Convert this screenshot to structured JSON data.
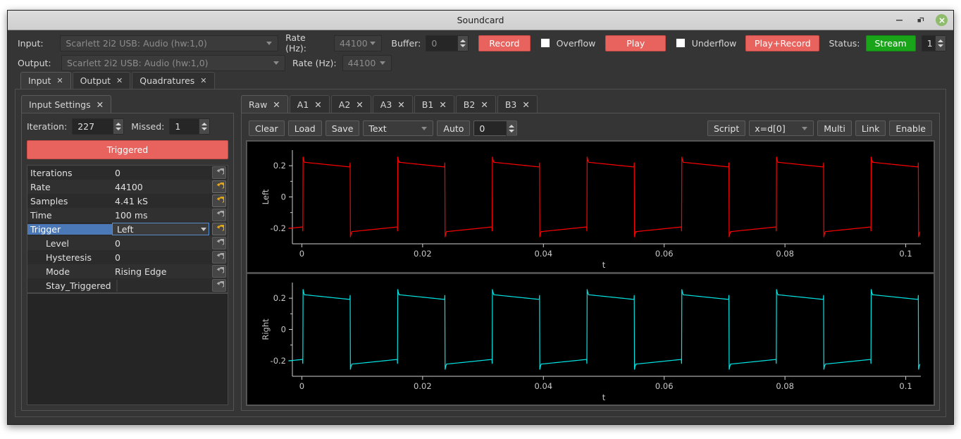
{
  "window": {
    "title": "Soundcard",
    "minimize_label": "minimize-icon",
    "restore_label": "restore-icon",
    "close_label": "×"
  },
  "toolbar": {
    "input_label": "Input:",
    "input_device": "Scarlett 2i2 USB: Audio (hw:1,0)",
    "output_label": "Output:",
    "output_device": "Scarlett 2i2 USB: Audio (hw:1,0)",
    "rate_label": "Rate (Hz):",
    "input_rate": "44100",
    "output_rate": "44100",
    "buffer_label": "Buffer:",
    "buffer_value": "0",
    "record_label": "Record",
    "overflow_label": "Overflow",
    "play_label": "Play",
    "underflow_label": "Underflow",
    "play_record_label": "Play+Record",
    "status_label": "Status:",
    "stream_label": "Stream",
    "stream_count": "1",
    "accent_red": "#e8635e",
    "accent_green": "#1aa41a"
  },
  "main_tabs": [
    {
      "label": "Input",
      "close": "✕",
      "active": true
    },
    {
      "label": "Output",
      "close": "✕",
      "active": false
    },
    {
      "label": "Quadratures",
      "close": "✕",
      "active": false
    }
  ],
  "left_panel": {
    "tab_label": "Input Settings",
    "tab_close": "✕",
    "iteration_label": "Iteration:",
    "iteration_value": "227",
    "missed_label": "Missed:",
    "missed_value": "1",
    "trigger_banner": "Triggered",
    "properties": [
      {
        "name": "Iterations",
        "value": "0",
        "indent": false,
        "selected": false,
        "reset_changed": false,
        "widget": "text"
      },
      {
        "name": "Rate",
        "value": "44100",
        "indent": false,
        "selected": false,
        "reset_changed": true,
        "widget": "text"
      },
      {
        "name": "Samples",
        "value": "4.41 kS",
        "indent": false,
        "selected": false,
        "reset_changed": true,
        "widget": "text"
      },
      {
        "name": "Time",
        "value": "100 ms",
        "indent": false,
        "selected": false,
        "reset_changed": false,
        "widget": "text"
      },
      {
        "name": "Trigger",
        "value": "Left",
        "indent": false,
        "selected": true,
        "reset_changed": true,
        "widget": "combo"
      },
      {
        "name": "Level",
        "value": "0",
        "indent": true,
        "selected": false,
        "reset_changed": false,
        "widget": "text"
      },
      {
        "name": "Hysteresis",
        "value": "0",
        "indent": true,
        "selected": false,
        "reset_changed": false,
        "widget": "text"
      },
      {
        "name": "Mode",
        "value": "Rising Edge",
        "indent": true,
        "selected": false,
        "reset_changed": false,
        "widget": "text"
      },
      {
        "name": "Stay_Triggered",
        "value": "",
        "indent": true,
        "selected": false,
        "reset_changed": false,
        "widget": "checkbox"
      }
    ]
  },
  "plot_tabs": [
    {
      "label": "Raw",
      "close": "✕",
      "active": true
    },
    {
      "label": "A1",
      "close": "✕",
      "active": false
    },
    {
      "label": "A2",
      "close": "✕",
      "active": false
    },
    {
      "label": "A3",
      "close": "✕",
      "active": false
    },
    {
      "label": "B1",
      "close": "✕",
      "active": false
    },
    {
      "label": "B2",
      "close": "✕",
      "active": false
    },
    {
      "label": "B3",
      "close": "✕",
      "active": false
    }
  ],
  "plot_toolbar": {
    "clear_label": "Clear",
    "load_label": "Load",
    "save_label": "Save",
    "format_value": "Text",
    "auto_label": "Auto",
    "auto_value": "0",
    "script_label": "Script",
    "xexpr_value": "x=d[0]",
    "multi_label": "Multi",
    "link_label": "Link",
    "enable_label": "Enable"
  },
  "chart_data": [
    {
      "type": "line",
      "title": "",
      "ylabel": "Left",
      "xlabel": "t",
      "color": "#ff0000",
      "background": "#000000",
      "xlim": [
        -0.0025,
        0.1025
      ],
      "ylim": [
        -0.3,
        0.3
      ],
      "xticks": [
        0,
        0.02,
        0.04,
        0.06,
        0.08,
        0.1
      ],
      "xticklabels": [
        "0",
        "0.02",
        "0.04",
        "0.06",
        "0.08",
        "0.1"
      ],
      "yticks": [
        -0.2,
        0,
        0.2
      ],
      "yticklabels": [
        "-0.2",
        "0",
        "0.2"
      ],
      "grid": false,
      "legend": null,
      "waveform": {
        "shape": "square",
        "period": 0.01568,
        "duty": 0.5,
        "high_start": 0.222,
        "high_end": 0.192,
        "low_start": -0.222,
        "low_end": -0.192,
        "overshoot": 0.035,
        "phase_offset": 0.0002,
        "ringing": true,
        "description": "Droopy AC-coupled square wave, ~63.8 Hz, amplitude +/-0.22 decaying toward +/-0.19 within each half period, with ringing spikes at each transition."
      }
    },
    {
      "type": "line",
      "title": "",
      "ylabel": "Right",
      "xlabel": "t",
      "color": "#00e5e5",
      "background": "#000000",
      "xlim": [
        -0.0025,
        0.1025
      ],
      "ylim": [
        -0.3,
        0.3
      ],
      "xticks": [
        0,
        0.02,
        0.04,
        0.06,
        0.08,
        0.1
      ],
      "xticklabels": [
        "0",
        "0.02",
        "0.04",
        "0.06",
        "0.08",
        "0.1"
      ],
      "yticks": [
        -0.2,
        0,
        0.2
      ],
      "yticklabels": [
        "-0.2",
        "0",
        "0.2"
      ],
      "grid": false,
      "legend": null,
      "waveform": {
        "shape": "square",
        "period": 0.01568,
        "duty": 0.5,
        "high_start": 0.222,
        "high_end": 0.192,
        "low_start": -0.222,
        "low_end": -0.192,
        "overshoot": 0.035,
        "phase_offset": 0.0002,
        "ringing": true,
        "description": "Droopy AC-coupled square wave, ~63.8 Hz, amplitude +/-0.22 decaying toward +/-0.19 within each half period, with ringing spikes at each transition."
      }
    }
  ]
}
